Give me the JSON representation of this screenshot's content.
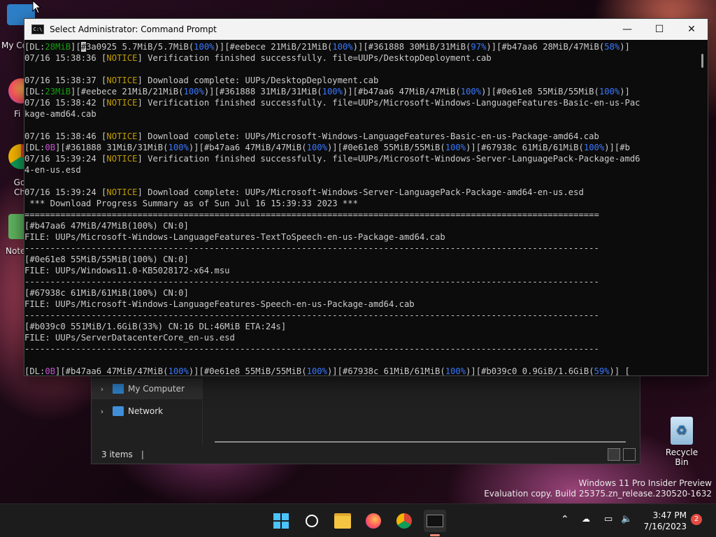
{
  "desktop": {
    "icons": [
      {
        "label": "My Co"
      },
      {
        "label": "Fi"
      },
      {
        "label": "Go Ch"
      },
      {
        "label": "Note"
      }
    ],
    "recycle_bin": "Recycle Bin",
    "watermark": {
      "line1": "Windows 11 Pro Insider Preview",
      "line2": "Evaluation copy. Build 25375.zn_release.230520-1632"
    }
  },
  "explorer": {
    "nav": [
      {
        "label": "My Computer",
        "selected": true
      },
      {
        "label": "Network",
        "selected": false
      }
    ],
    "status_count": "3 items",
    "status_cursor": "|"
  },
  "console": {
    "title": "Select Administrator:  Command Prompt",
    "icon_text": "C:\\",
    "controls": {
      "minimize": "—",
      "maximize": "☐",
      "close": "✕"
    },
    "lines": [
      [
        [
          "[DL:",
          ""
        ],
        [
          "28MiB",
          "green"
        ],
        [
          "][",
          ""
        ],
        [
          "#",
          "cursor"
        ],
        [
          "3a0925 5.7MiB/5.7MiB(",
          ""
        ],
        [
          "100%",
          "blue"
        ],
        [
          ")][#eebece 21MiB/21MiB(",
          ""
        ],
        [
          "100%",
          "blue"
        ],
        [
          ")][#361888 30MiB/31MiB(",
          ""
        ],
        [
          "97%",
          "blue"
        ],
        [
          ")][#b47aa6 28MiB/47MiB(",
          ""
        ],
        [
          "58%",
          "blue"
        ],
        [
          ")]",
          ""
        ]
      ],
      [
        [
          "07/16 15:38:36 [",
          ""
        ],
        [
          "NOTICE",
          "yellow"
        ],
        [
          "] Verification finished successfully. file=UUPs/DesktopDeployment.cab",
          ""
        ]
      ],
      [
        [
          "",
          ""
        ]
      ],
      [
        [
          "07/16 15:38:37 [",
          ""
        ],
        [
          "NOTICE",
          "yellow"
        ],
        [
          "] Download complete: UUPs/DesktopDeployment.cab",
          ""
        ]
      ],
      [
        [
          "[DL:",
          ""
        ],
        [
          "23MiB",
          "green"
        ],
        [
          "][#eebece 21MiB/21MiB(",
          ""
        ],
        [
          "100%",
          "blue"
        ],
        [
          ")][#361888 31MiB/31MiB(",
          ""
        ],
        [
          "100%",
          "blue"
        ],
        [
          ")][#b47aa6 47MiB/47MiB(",
          ""
        ],
        [
          "100%",
          "blue"
        ],
        [
          ")][#0e61e8 55MiB/55MiB(",
          ""
        ],
        [
          "100%",
          "blue"
        ],
        [
          ")]",
          ""
        ]
      ],
      [
        [
          "07/16 15:38:42 [",
          ""
        ],
        [
          "NOTICE",
          "yellow"
        ],
        [
          "] Verification finished successfully. file=UUPs/Microsoft-Windows-LanguageFeatures-Basic-en-us-Pac",
          ""
        ]
      ],
      [
        [
          "kage-amd64.cab",
          ""
        ]
      ],
      [
        [
          "",
          ""
        ]
      ],
      [
        [
          "07/16 15:38:46 [",
          ""
        ],
        [
          "NOTICE",
          "yellow"
        ],
        [
          "] Download complete: UUPs/Microsoft-Windows-LanguageFeatures-Basic-en-us-Package-amd64.cab",
          ""
        ]
      ],
      [
        [
          "[DL:",
          ""
        ],
        [
          "0B",
          "purple"
        ],
        [
          "][#361888 31MiB/31MiB(",
          ""
        ],
        [
          "100%",
          "blue"
        ],
        [
          ")][#b47aa6 47MiB/47MiB(",
          ""
        ],
        [
          "100%",
          "blue"
        ],
        [
          ")][#0e61e8 55MiB/55MiB(",
          ""
        ],
        [
          "100%",
          "blue"
        ],
        [
          ")][#67938c 61MiB/61MiB(",
          ""
        ],
        [
          "100%",
          "blue"
        ],
        [
          ")][#b",
          ""
        ]
      ],
      [
        [
          "07/16 15:39:24 [",
          ""
        ],
        [
          "NOTICE",
          "yellow"
        ],
        [
          "] Verification finished successfully. file=UUPs/Microsoft-Windows-Server-LanguagePack-Package-amd6",
          ""
        ]
      ],
      [
        [
          "4-en-us.esd",
          ""
        ]
      ],
      [
        [
          "",
          ""
        ]
      ],
      [
        [
          "07/16 15:39:24 [",
          ""
        ],
        [
          "NOTICE",
          "yellow"
        ],
        [
          "] Download complete: UUPs/Microsoft-Windows-Server-LanguagePack-Package-amd64-en-us.esd",
          ""
        ]
      ],
      [
        [
          " *** Download Progress Summary as of Sun Jul 16 15:39:33 2023 ***",
          ""
        ]
      ],
      [
        [
          "================================================================================================================",
          ""
        ]
      ],
      [
        [
          "[#b47aa6 47MiB/47MiB(100%) CN:0]",
          ""
        ]
      ],
      [
        [
          "FILE: UUPs/Microsoft-Windows-LanguageFeatures-TextToSpeech-en-us-Package-amd64.cab",
          ""
        ]
      ],
      [
        [
          "----------------------------------------------------------------------------------------------------------------",
          ""
        ]
      ],
      [
        [
          "[#0e61e8 55MiB/55MiB(100%) CN:0]",
          ""
        ]
      ],
      [
        [
          "FILE: UUPs/Windows11.0-KB5028172-x64.msu",
          ""
        ]
      ],
      [
        [
          "----------------------------------------------------------------------------------------------------------------",
          ""
        ]
      ],
      [
        [
          "[#67938c 61MiB/61MiB(100%) CN:0]",
          ""
        ]
      ],
      [
        [
          "FILE: UUPs/Microsoft-Windows-LanguageFeatures-Speech-en-us-Package-amd64.cab",
          ""
        ]
      ],
      [
        [
          "----------------------------------------------------------------------------------------------------------------",
          ""
        ]
      ],
      [
        [
          "[#b039c0 551MiB/1.6GiB(33%) CN:16 DL:46MiB ETA:24s]",
          ""
        ]
      ],
      [
        [
          "FILE: UUPs/ServerDatacenterCore_en-us.esd",
          ""
        ]
      ],
      [
        [
          "----------------------------------------------------------------------------------------------------------------",
          ""
        ]
      ],
      [
        [
          "",
          ""
        ]
      ],
      [
        [
          "[DL:",
          ""
        ],
        [
          "0B",
          "purple"
        ],
        [
          "][#b47aa6 47MiB/47MiB(",
          ""
        ],
        [
          "100%",
          "blue"
        ],
        [
          ")][#0e61e8 55MiB/55MiB(",
          ""
        ],
        [
          "100%",
          "blue"
        ],
        [
          ")][#67938c 61MiB/61MiB(",
          ""
        ],
        [
          "100%",
          "blue"
        ],
        [
          ")][#b039c0 0.9GiB/1.6GiB(",
          ""
        ],
        [
          "59%",
          "blue"
        ],
        [
          ")] [",
          ""
        ]
      ]
    ]
  },
  "taskbar": {
    "apps": [
      {
        "name": "start"
      },
      {
        "name": "search"
      },
      {
        "name": "file-explorer"
      },
      {
        "name": "firefox"
      },
      {
        "name": "chrome"
      },
      {
        "name": "terminal",
        "active": true
      }
    ],
    "time": "3:47 PM",
    "date": "7/16/2023",
    "notification_count": "2"
  }
}
